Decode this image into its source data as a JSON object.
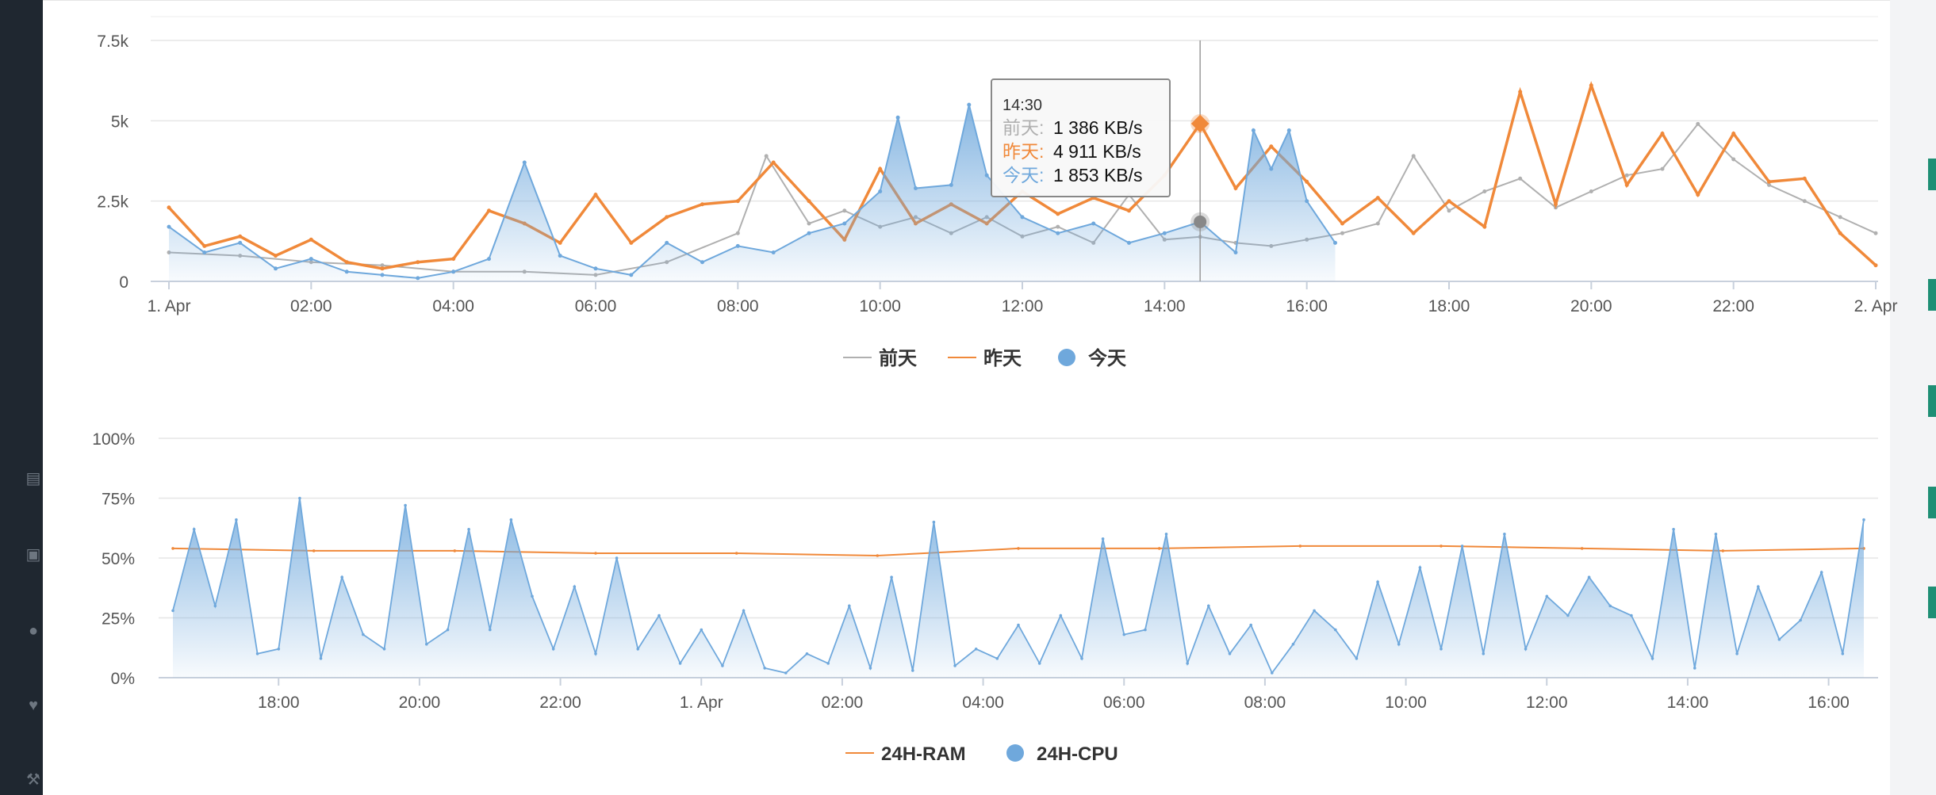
{
  "sidebar_icons": [
    "credit-card-icon",
    "money-icon",
    "chat-icon",
    "heart-icon",
    "wrench-icon"
  ],
  "colors": {
    "before_yesterday": "#b0b0b0",
    "yesterday": "#f0893a",
    "today": "#6fa8dc",
    "ram": "#f0893a",
    "cpu": "#6fa8dc",
    "sidebar": "#1f2730",
    "accent_tab": "#1e8f75"
  },
  "chart_data": [
    {
      "type": "line",
      "title": "",
      "ylim": [
        0,
        7500
      ],
      "y_ticks": [
        "0",
        "2.5k",
        "5k",
        "7.5k"
      ],
      "x_ticks": [
        "1. Apr",
        "02:00",
        "04:00",
        "06:00",
        "08:00",
        "10:00",
        "12:00",
        "14:00",
        "16:00",
        "18:00",
        "20:00",
        "22:00",
        "2. Apr"
      ],
      "x_start": "00:00",
      "x_end": "24:00",
      "legend": [
        {
          "name": "前天",
          "style": "line"
        },
        {
          "name": "昨天",
          "style": "line"
        },
        {
          "name": "今天",
          "style": "area"
        }
      ],
      "tooltip": {
        "time": "14:30",
        "rows": [
          {
            "name": "前天",
            "value": "1 386 KB/s"
          },
          {
            "name": "昨天",
            "value": "4 911 KB/s"
          },
          {
            "name": "今天",
            "value": "1 853 KB/s"
          }
        ]
      },
      "series": [
        {
          "name": "前天",
          "unit": "KB/s",
          "hours": [
            0,
            1,
            2,
            3,
            4,
            5,
            6,
            7,
            8,
            8.4,
            9,
            9.5,
            10,
            10.5,
            11,
            11.5,
            12,
            12.5,
            13,
            13.5,
            14,
            14.5,
            15,
            15.5,
            16,
            16.5,
            17,
            17.5,
            18,
            18.5,
            19,
            19.5,
            20,
            20.5,
            21,
            21.5,
            22,
            22.5,
            23,
            23.5,
            24
          ],
          "values": [
            900,
            800,
            600,
            500,
            300,
            300,
            200,
            600,
            1500,
            3900,
            1800,
            2200,
            1700,
            2000,
            1500,
            2000,
            1400,
            1700,
            1200,
            2700,
            1300,
            1386,
            1200,
            1100,
            1300,
            1500,
            1800,
            3900,
            2200,
            2800,
            3200,
            2300,
            2800,
            3300,
            3500,
            4900,
            3800,
            3000,
            2500,
            2000,
            1500
          ]
        },
        {
          "name": "昨天",
          "unit": "KB/s",
          "hours": [
            0,
            0.5,
            1,
            1.5,
            2,
            2.5,
            3,
            3.5,
            4,
            4.5,
            5,
            5.5,
            6,
            6.5,
            7,
            7.5,
            8,
            8.5,
            9,
            9.5,
            10,
            10.5,
            11,
            11.5,
            12,
            12.5,
            13,
            13.5,
            14,
            14.5,
            15,
            15.5,
            16,
            16.5,
            17,
            17.5,
            18,
            18.5,
            19,
            19.5,
            20,
            20.5,
            21,
            21.5,
            22,
            22.5,
            23,
            23.5,
            24
          ],
          "values": [
            2300,
            1100,
            1400,
            800,
            1300,
            600,
            400,
            600,
            700,
            2200,
            1800,
            1200,
            2700,
            1200,
            2000,
            2400,
            2500,
            3700,
            2500,
            1300,
            3500,
            1800,
            2400,
            1800,
            2800,
            2100,
            2600,
            2200,
            3300,
            4911,
            2900,
            4200,
            3100,
            1800,
            2600,
            1500,
            2500,
            1700,
            5900,
            2400,
            6100,
            3000,
            4600,
            2700,
            4600,
            3100,
            3200,
            1500,
            500
          ]
        },
        {
          "name": "今天",
          "unit": "KB/s",
          "hours": [
            0,
            0.5,
            1,
            1.5,
            2,
            2.5,
            3,
            3.5,
            4,
            4.5,
            5,
            5.5,
            6,
            6.5,
            7,
            7.5,
            8,
            8.5,
            9,
            9.5,
            10,
            10.25,
            10.5,
            11,
            11.25,
            11.5,
            12,
            12.5,
            13,
            13.5,
            14,
            14.5,
            15,
            15.25,
            15.5,
            15.75,
            16,
            16.4
          ],
          "values": [
            1700,
            900,
            1200,
            400,
            700,
            300,
            200,
            100,
            300,
            700,
            3700,
            800,
            400,
            200,
            1200,
            600,
            1100,
            900,
            1500,
            1800,
            2800,
            5100,
            2900,
            3000,
            5500,
            3300,
            2000,
            1500,
            1800,
            1200,
            1500,
            1853,
            900,
            4700,
            3500,
            4700,
            2500,
            1200
          ]
        }
      ]
    },
    {
      "type": "area",
      "title": "",
      "ylim": [
        0,
        100
      ],
      "y_ticks": [
        "0%",
        "25%",
        "50%",
        "75%",
        "100%"
      ],
      "x_ticks": [
        "18:00",
        "20:00",
        "22:00",
        "1. Apr",
        "02:00",
        "04:00",
        "06:00",
        "08:00",
        "10:00",
        "12:00",
        "14:00",
        "16:00"
      ],
      "x_start": "16:30 (previous day)",
      "x_end": "16:30",
      "legend": [
        {
          "name": "24H-RAM",
          "style": "line"
        },
        {
          "name": "24H-CPU",
          "style": "area"
        }
      ],
      "series": [
        {
          "name": "24H-RAM",
          "unit": "%",
          "hours": [
            0,
            2,
            4,
            6,
            8,
            10,
            12,
            14,
            16,
            18,
            20,
            22,
            24
          ],
          "values": [
            54,
            53,
            53,
            52,
            52,
            51,
            54,
            54,
            55,
            55,
            54,
            53,
            54
          ]
        },
        {
          "name": "24H-CPU",
          "unit": "%",
          "hours": [
            0,
            0.3,
            0.6,
            0.9,
            1.2,
            1.5,
            1.8,
            2.1,
            2.4,
            2.7,
            3.0,
            3.3,
            3.6,
            3.9,
            4.2,
            4.5,
            4.8,
            5.1,
            5.4,
            5.7,
            6.0,
            6.3,
            6.6,
            6.9,
            7.2,
            7.5,
            7.8,
            8.1,
            8.4,
            8.7,
            9.0,
            9.3,
            9.6,
            9.9,
            10.2,
            10.5,
            10.8,
            11.1,
            11.4,
            11.7,
            12.0,
            12.3,
            12.6,
            12.9,
            13.2,
            13.5,
            13.8,
            14.1,
            14.4,
            14.7,
            15.0,
            15.3,
            15.6,
            15.9,
            16.2,
            16.5,
            16.8,
            17.1,
            17.4,
            17.7,
            18.0,
            18.3,
            18.6,
            18.9,
            19.2,
            19.5,
            19.8,
            20.1,
            20.4,
            20.7,
            21.0,
            21.3,
            21.6,
            21.9,
            22.2,
            22.5,
            22.8,
            23.1,
            23.4,
            23.7,
            24
          ],
          "values": [
            28,
            62,
            30,
            66,
            10,
            12,
            75,
            8,
            42,
            18,
            12,
            72,
            14,
            20,
            62,
            20,
            66,
            34,
            12,
            38,
            10,
            50,
            12,
            26,
            6,
            20,
            5,
            28,
            4,
            2,
            10,
            6,
            30,
            4,
            42,
            3,
            65,
            5,
            12,
            8,
            22,
            6,
            26,
            8,
            58,
            18,
            20,
            60,
            6,
            30,
            10,
            22,
            2,
            14,
            28,
            20,
            8,
            40,
            14,
            46,
            12,
            55,
            10,
            60,
            12,
            34,
            26,
            42,
            30,
            26,
            8,
            62,
            4,
            60,
            10,
            38,
            16,
            24,
            44,
            10,
            66
          ]
        }
      ]
    }
  ]
}
